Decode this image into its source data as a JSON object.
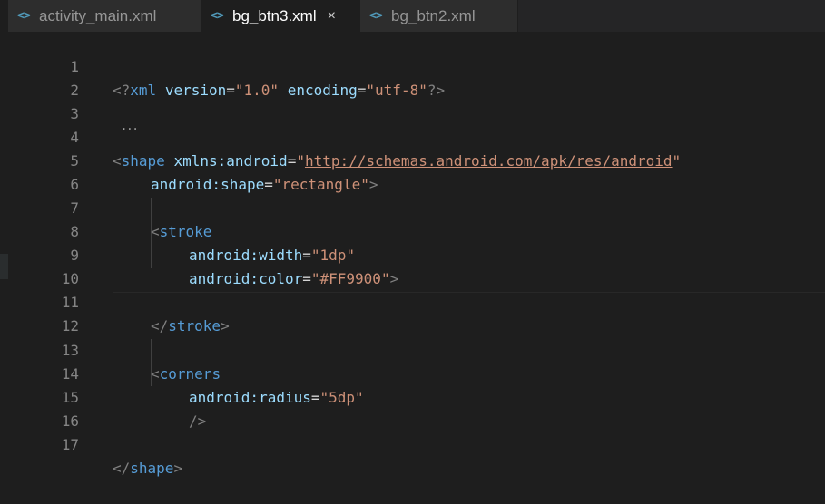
{
  "tabs": [
    {
      "icon": "<>",
      "label": "activity_main.xml"
    },
    {
      "icon": "<>",
      "label": "bg_btn3.xml",
      "close": "×"
    },
    {
      "icon": "<>",
      "label": "bg_btn2.xml"
    }
  ],
  "gutter": [
    "1",
    "2",
    "3",
    "4",
    "5",
    "6",
    "7",
    "8",
    "9",
    "10",
    "11",
    "12",
    "13",
    "14",
    "15",
    "16",
    "17"
  ],
  "code": {
    "l1": {
      "open": "<?",
      "tag": "xml",
      "a1": "version",
      "eq": "=",
      "v1": "\"1.0\"",
      "a2": "encoding",
      "v2": "\"utf-8\"",
      "close": "?>"
    },
    "l4": {
      "open": "<",
      "tag": "shape",
      "attr": "xmlns:android",
      "eq": "=",
      "q1": "\"",
      "url": "http://schemas.android.com/apk/res/android",
      "q2": "\""
    },
    "l5": {
      "attr": "android:shape",
      "eq": "=",
      "val": "\"rectangle\"",
      "close": ">"
    },
    "l7": {
      "open": "<",
      "tag": "stroke"
    },
    "l8": {
      "attr": "android:width",
      "eq": "=",
      "val": "\"1dp\""
    },
    "l9": {
      "attr": "android:color",
      "eq": "=",
      "val": "\"#FF9900\"",
      "close": ">"
    },
    "l11": {
      "open": "</",
      "tag": "stroke",
      "close": ">"
    },
    "l13": {
      "open": "<",
      "tag": "corners"
    },
    "l14": {
      "attr": "android:radius",
      "eq": "=",
      "val": "\"5dp\""
    },
    "l15": {
      "close": "/>"
    },
    "l17": {
      "open": "</",
      "tag": "shape",
      "close": ">"
    }
  },
  "fold_hint": "..."
}
